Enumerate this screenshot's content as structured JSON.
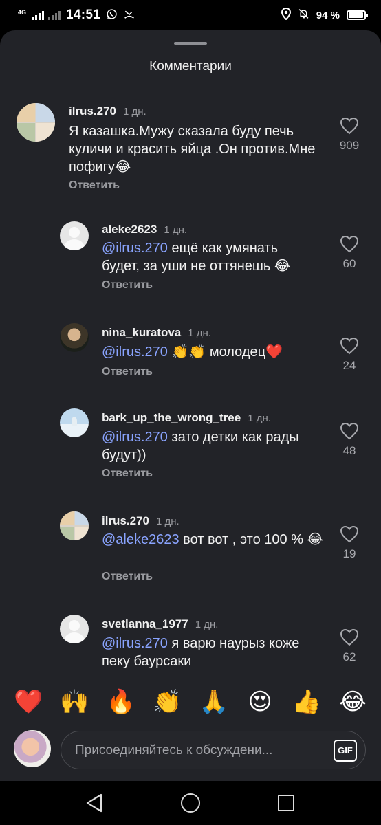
{
  "status_bar": {
    "network": "4G",
    "time": "14:51",
    "battery_percent": "94 %",
    "battery_level": 0.94,
    "icons": [
      "whatsapp-icon",
      "missed-call-icon",
      "location-icon",
      "alarm-off-icon"
    ]
  },
  "sheet": {
    "title": "Комментарии"
  },
  "comments": [
    {
      "user": "ilrus.270",
      "time": "1 дн.",
      "mention": "",
      "text": "Я казашка.Мужу сказала буду печь куличи и красить яйца .Он против.Мне пофигу😂",
      "reply_label": "Ответить",
      "likes": "909",
      "avatar": "mosaic"
    },
    {
      "user": "aleke2623",
      "time": "1 дн.",
      "mention": "@ilrus.270",
      "text": " ещё как умянать будет, за уши не оттянешь 😂",
      "reply_label": "Ответить",
      "likes": "60",
      "avatar": "default"
    },
    {
      "user": "nina_kuratova",
      "time": "1 дн.",
      "mention": "@ilrus.270",
      "text": " 👏👏 молодец❤️",
      "reply_label": "Ответить",
      "likes": "24",
      "avatar": "photo-woman"
    },
    {
      "user": "bark_up_the_wrong_tree",
      "time": "1 дн.",
      "mention": "@ilrus.270",
      "text": " зато детки как рады будут))",
      "reply_label": "Ответить",
      "likes": "48",
      "avatar": "photo-tree"
    },
    {
      "user": "ilrus.270",
      "time": "1 дн.",
      "mention": "@aleke2623",
      "text": " вот вот , это 100 % 😂",
      "reply_label": "Ответить",
      "likes": "19",
      "avatar": "mosaic"
    },
    {
      "user": "svetlanna_1977",
      "time": "1 дн.",
      "mention": "@ilrus.270",
      "text": " я варю наурыз коже пеку баурсаки",
      "reply_label": "",
      "likes": "62",
      "avatar": "default"
    }
  ],
  "emoji_bar": [
    "❤️",
    "🙌",
    "🔥",
    "👏",
    "🙏",
    "😍",
    "👍",
    "😂"
  ],
  "input": {
    "placeholder": "Присоединяйтесь к обсуждени...",
    "gif_label": "GIF"
  },
  "nav_bar": {
    "icons": [
      "back-icon",
      "home-icon",
      "recent-apps-icon"
    ]
  }
}
